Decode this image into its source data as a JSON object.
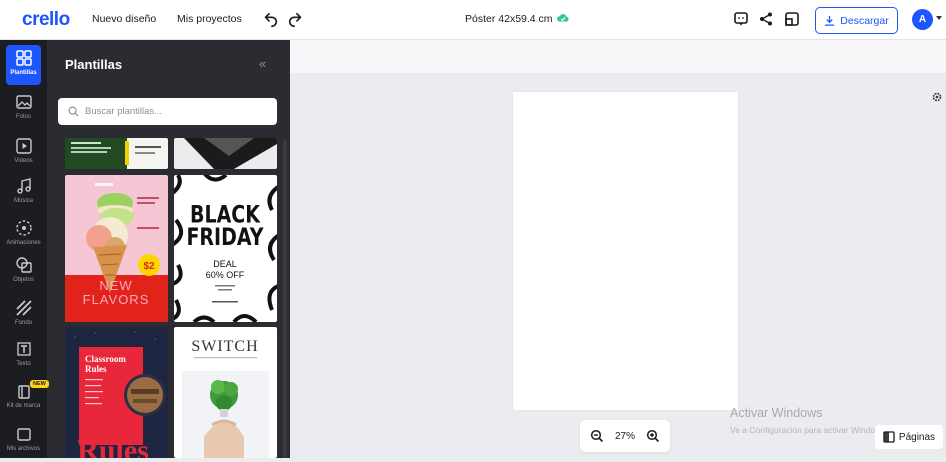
{
  "header": {
    "logo": "crello",
    "nav": [
      "Nuevo diseño",
      "Mis proyectos"
    ],
    "doc_title": "Póster 42x59.4 cm",
    "download_label": "Descargar",
    "avatar_letter": "A"
  },
  "rail": {
    "items": [
      {
        "label": "Plantillas",
        "icon": "templates-icon",
        "active": true
      },
      {
        "label": "Fotos",
        "icon": "photos-icon"
      },
      {
        "label": "Videos",
        "icon": "videos-icon"
      },
      {
        "label": "Música",
        "icon": "music-icon"
      },
      {
        "label": "Animaciones",
        "icon": "animations-icon"
      },
      {
        "label": "Objetos",
        "icon": "objects-icon"
      },
      {
        "label": "Fondo",
        "icon": "background-icon"
      },
      {
        "label": "Texto",
        "icon": "text-icon"
      },
      {
        "label": "Kit de marca",
        "icon": "brand-kit-icon",
        "badge": "NEW"
      },
      {
        "label": "Mis archivos",
        "icon": "my-files-icon"
      }
    ]
  },
  "panel": {
    "title": "Plantillas",
    "collapse": "«",
    "search_placeholder": "Buscar plantillas..."
  },
  "templates": {
    "macaron": {
      "price": "$2",
      "line1": "NEW",
      "line2": "FLAVORS"
    },
    "black_friday": {
      "line1": "BLACK",
      "line2": "FRIDAY",
      "line3": "DEAL",
      "line4": "60% OFF"
    },
    "classroom": {
      "title1": "Classroom",
      "title2": "Rules",
      "big": "Rules"
    },
    "switch": {
      "title": "SWITCH"
    }
  },
  "canvas": {
    "zoom": "27%",
    "pages_label": "Páginas",
    "watermark_title": "Activar Windows",
    "watermark_sub": "Ve a Configuración para activar Windows."
  },
  "colors": {
    "accent": "#1d56ff",
    "panel": "#2b2c31",
    "rail": "#1c1d21"
  }
}
